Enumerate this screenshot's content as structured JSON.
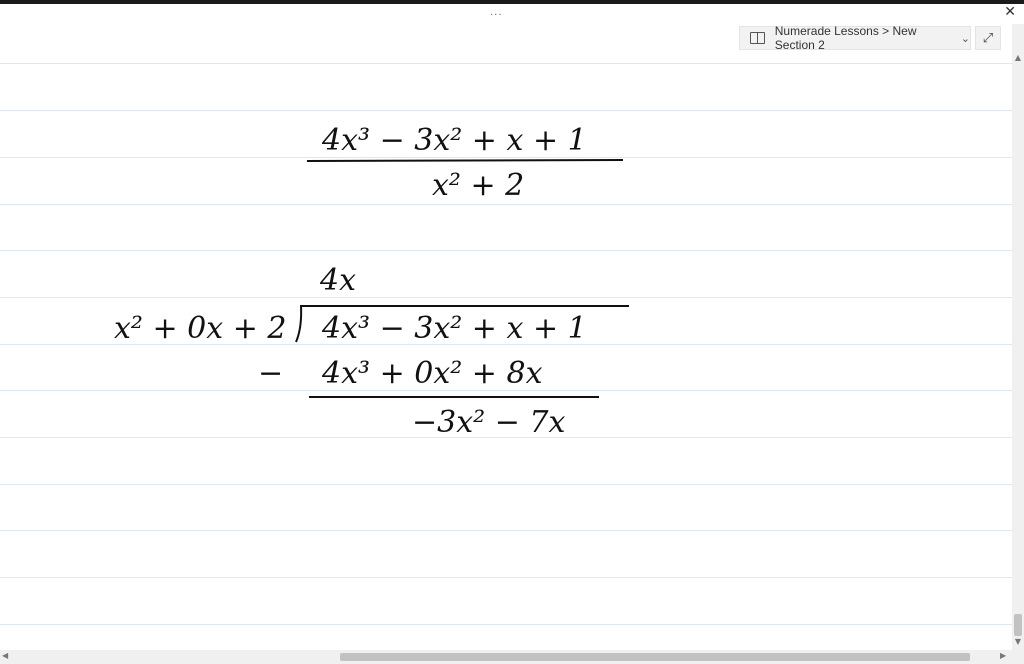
{
  "window": {
    "title_dots": "...",
    "close_label": "✕"
  },
  "notebook": {
    "breadcrumb": "Numerade Lessons > New Section 2",
    "expand_icon": "expand-icon"
  },
  "math": {
    "fraction": {
      "numerator": "4x³ − 3x² + x + 1",
      "denominator": "x² + 2"
    },
    "long_division": {
      "quotient": "4x",
      "divisor": "x² + 0x + 2",
      "dividend": "4x³ − 3x² + x + 1",
      "minus_sign": "−",
      "subtracted": "4x³ + 0x² + 8x",
      "remainder": "−3x² − 7x"
    }
  }
}
